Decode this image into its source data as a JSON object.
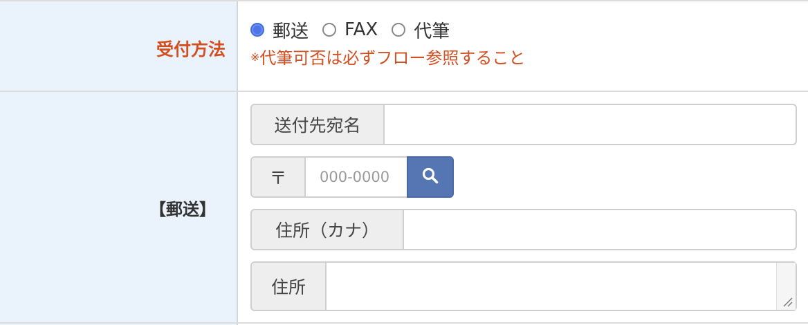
{
  "rows": {
    "method": {
      "label": "受付方法",
      "options": [
        {
          "label": "郵送",
          "checked": true
        },
        {
          "label": "FAX",
          "checked": false
        },
        {
          "label": "代筆",
          "checked": false
        }
      ],
      "note_mark": "※",
      "note": "代筆可否は必ずフロー参照すること"
    },
    "mail": {
      "label": "【郵送】",
      "recipient": {
        "label": "送付先宛名",
        "value": ""
      },
      "zip": {
        "symbol": "〒",
        "placeholder": "000-0000",
        "value": ""
      },
      "address_kana": {
        "label": "住所（カナ）",
        "value": ""
      },
      "address": {
        "label": "住所",
        "value": ""
      }
    }
  },
  "icons": {
    "search": "search-icon",
    "resize": "resize-handle-icon"
  },
  "colors": {
    "label_bg": "#eaf3fc",
    "required_text": "#d24f22",
    "search_button": "#5676b3",
    "radio_checked": "#4f74e8"
  }
}
